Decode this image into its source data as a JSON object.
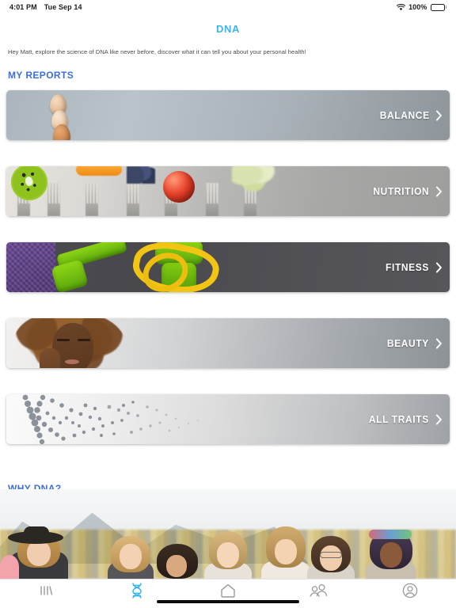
{
  "status_bar": {
    "time": "4:01 PM",
    "date": "Tue Sep 14",
    "wifi_icon": "wifi-icon",
    "battery_percent": "100%",
    "battery_icon": "battery-full-icon"
  },
  "header": {
    "title": "DNA",
    "title_color": "#38b6ef"
  },
  "greeting": {
    "text": "Hey Matt, explore the science of DNA like never before, discover what it can tell you about your personal health!"
  },
  "sections": {
    "my_reports": "MY REPORTS",
    "why_dna": "WHY DNA?",
    "heading_color": "#3b6fd4"
  },
  "reports": [
    {
      "label": "BALANCE",
      "chevron_icon": "chevron-right-icon",
      "art": "eggs-photo"
    },
    {
      "label": "NUTRITION",
      "chevron_icon": "chevron-right-icon",
      "art": "forks-with-produce-photo"
    },
    {
      "label": "FITNESS",
      "chevron_icon": "chevron-right-icon",
      "art": "dumbbells-yoga-mat-tape-photo"
    },
    {
      "label": "BEAUTY",
      "chevron_icon": "chevron-right-icon",
      "art": "woman-touching-face-photo"
    },
    {
      "label": "ALL TRAITS",
      "chevron_icon": "chevron-right-icon",
      "art": "dna-helix-dots-photo"
    }
  ],
  "why_dna_media": {
    "art": "group-of-women-outdoors-photo"
  },
  "tabbar": {
    "items": [
      {
        "name": "bars-icon",
        "active": false
      },
      {
        "name": "dna-icon",
        "active": true
      },
      {
        "name": "home-icon",
        "active": false
      },
      {
        "name": "people-icon",
        "active": false
      },
      {
        "name": "profile-icon",
        "active": false
      }
    ],
    "active_color": "#38b6ef",
    "inactive_color": "#9a9a9e"
  }
}
